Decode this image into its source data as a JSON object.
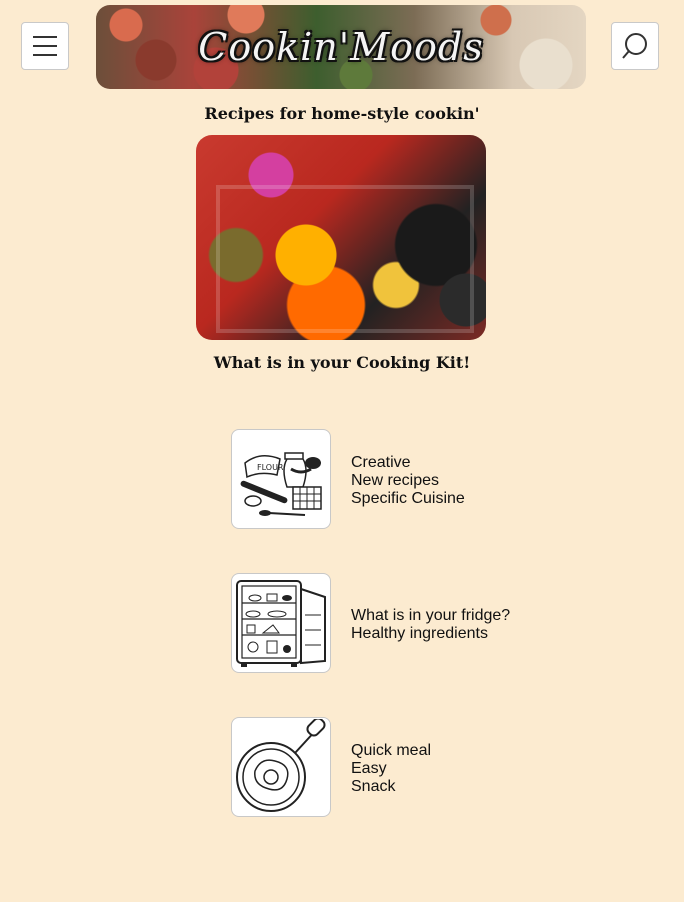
{
  "header": {
    "menu_icon": "hamburger-menu-icon",
    "search_icon": "search-icon",
    "banner_title": "Cookin'Moods"
  },
  "tagline": "Recipes for home-style cookin'",
  "kit_heading": "What is in your Cooking Kit!",
  "kit_items": [
    {
      "icon": "baking-tools-icon",
      "lines": [
        "Creative",
        "New recipes",
        "Specific Cuisine"
      ]
    },
    {
      "icon": "fridge-icon",
      "lines": [
        "What is in your fridge?",
        "Healthy ingredients"
      ]
    },
    {
      "icon": "frying-pan-icon",
      "lines": [
        "Quick meal",
        "Easy",
        "Snack"
      ]
    }
  ],
  "colors": {
    "background": "#fcebd0",
    "text": "#111111"
  }
}
